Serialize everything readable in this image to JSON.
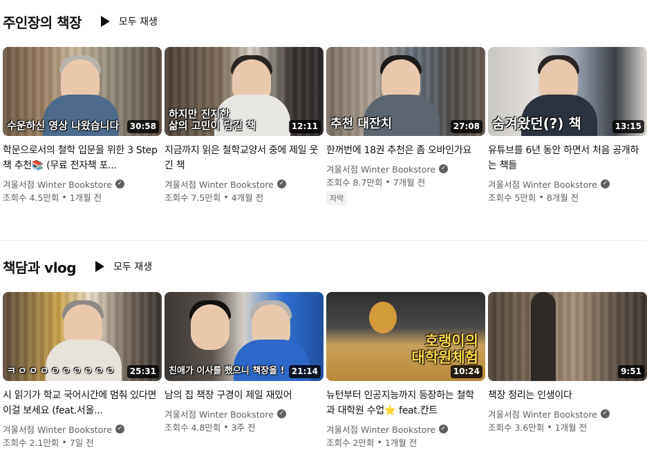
{
  "shelves": [
    {
      "title": "주인장의 책장",
      "play_all": "모두 재생",
      "videos": [
        {
          "overlay": "수운하신 영상 나왔습니다",
          "duration": "30:58",
          "title": "학문으로서의 철학 입문을 위한 3 Step 책 추천📚 (무료 전자책 포...",
          "channel": "겨울서점 Winter Bookstore",
          "views": "조회수 4.5만회",
          "age": "1개월 전",
          "badge": ""
        },
        {
          "overlay": "하지만 진지한\n삶의 고민이 담긴 책",
          "duration": "12:11",
          "title": "지금까지 읽은 철학교양서 중에 제일 웃긴 책",
          "channel": "겨울서점 Winter Bookstore",
          "views": "조회수 7.5만회",
          "age": "4개월 전",
          "badge": ""
        },
        {
          "overlay": "추천 대잔치",
          "duration": "27:08",
          "title": "한꺼번에 18권 추천은 좀 오바인가요",
          "channel": "겨울서점 Winter Bookstore",
          "views": "조회수 8.7만회",
          "age": "7개월 전",
          "badge": "자막"
        },
        {
          "overlay": "숨겨왔던(?) 책",
          "duration": "13:15",
          "title": "유튜브를 6년 동안 하면서 처음 공개하는 책들",
          "channel": "겨울서점 Winter Bookstore",
          "views": "조회수 5만회",
          "age": "8개월 전",
          "badge": ""
        }
      ]
    },
    {
      "title": "책담과 vlog",
      "play_all": "모두 재생",
      "videos": [
        {
          "overlay": "ㅋㅇㅇㅇㅇㅇㅇㅇㅇㅇ",
          "duration": "25:31",
          "title": "시 읽기가 학교 국어시간에 멈춰 있다면 이걸 보세요 (feat.서울...",
          "channel": "겨울서점 Winter Bookstore",
          "views": "조회수 2.1만회",
          "age": "7일 전",
          "badge": ""
        },
        {
          "overlay": "친애가 이사를 했으니 책장을 !",
          "duration": "21:14",
          "title": "남의 집 책장 구경이 제일 재밌어",
          "channel": "겨울서점 Winter Bookstore",
          "views": "조회수 4.8만회",
          "age": "3주 전",
          "badge": ""
        },
        {
          "overlay": "호랭이의\n대학원체험",
          "duration": "10:24",
          "title": "뉴턴부터 인공지능까지 등장하는 철학과 대학원 수업⭐ feat.칸트",
          "channel": "겨울서점 Winter Bookstore",
          "views": "조회수 2만회",
          "age": "1개월 전",
          "badge": ""
        },
        {
          "overlay": "",
          "duration": "9:51",
          "title": "책장 정리는 인생이다",
          "channel": "겨울서점 Winter Bookstore",
          "views": "조회수 3.6만회",
          "age": "1개월 전",
          "badge": ""
        }
      ]
    }
  ],
  "icons": {
    "play_all": "play-icon",
    "verified": "verified-check-icon"
  },
  "colors": {
    "text": "#0f0f0f",
    "meta": "#606060",
    "duration_bg": "#000000cc"
  }
}
